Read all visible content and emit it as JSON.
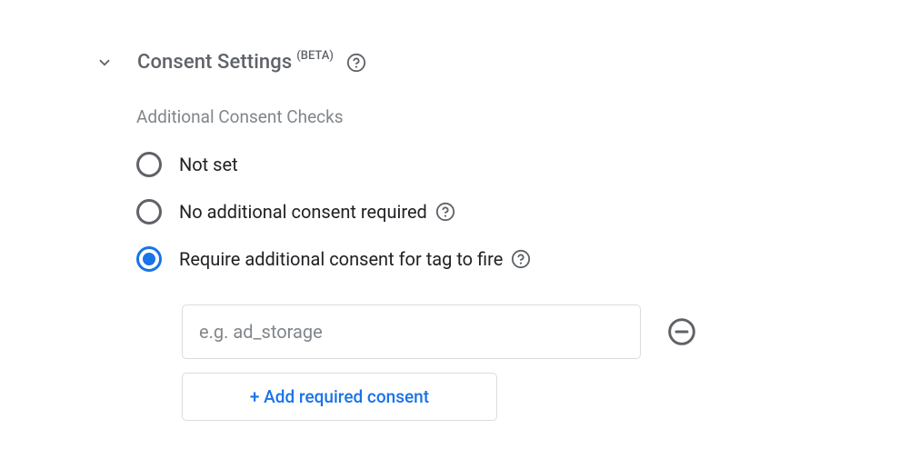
{
  "section": {
    "title": "Consent Settings",
    "beta": "(BETA)",
    "subsection_label": "Additional Consent Checks",
    "options": [
      {
        "label": "Not set",
        "selected": false,
        "help": false
      },
      {
        "label": "No additional consent required",
        "selected": false,
        "help": true
      },
      {
        "label": "Require additional consent for tag to fire",
        "selected": true,
        "help": true
      }
    ],
    "input": {
      "placeholder": "e.g. ad_storage",
      "value": ""
    },
    "add_button": "+ Add required consent"
  }
}
